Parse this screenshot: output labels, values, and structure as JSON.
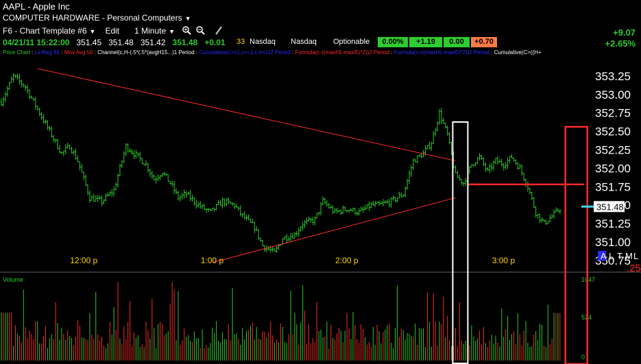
{
  "header": {
    "title": "AAPL - Apple Inc",
    "industry": "COMPUTER HARDWARE - Personal Computers",
    "template": "F6 - Chart Template #6",
    "edit": "Edit",
    "interval": "1 Minute",
    "zoom_in_icon": "zoom-in-icon",
    "zoom_out_icon": "zoom-out-icon",
    "draw_icon": "pencil-icon",
    "exch_count": "33",
    "exch1": "Nasdaq",
    "exch2": "Nasdaq",
    "optionable": "Optionable",
    "box1": "0.00%",
    "box2": "+1.19",
    "box3": "0.00",
    "box4": "+0.70",
    "change_abs": "+9.07",
    "change_pct": "+2.65%"
  },
  "quote": {
    "datetime": "04/21/11 15:22:00",
    "open": "351.45",
    "high": "351.48",
    "low": "351.42",
    "close": "351.48",
    "change": "+0.01"
  },
  "legend": [
    {
      "text": "Price Chart",
      "color": "#2ecc2e"
    },
    {
      "text": " : ",
      "color": "#ffd400"
    },
    {
      "text": "LinReg 65",
      "color": "#2a2aff"
    },
    {
      "text": " : ",
      "color": "#ffd400"
    },
    {
      "text": "Mov Avg 50",
      "color": "#ff2a2a"
    },
    {
      "text": " : ",
      "color": "#ffd400"
    },
    {
      "text": "Channel(c,H-(.5*(.5*(avgH15...)1 Period",
      "color": "#ffffff"
    },
    {
      "text": " : ",
      "color": "#ffd400"
    },
    {
      "text": "Cumulative(c>c1,c<c1,c-h<c)2 Period",
      "color": "#2a2aff"
    },
    {
      "text": " : ",
      "color": "#ffd400"
    },
    {
      "text": "Formula(c-((maxh5-maxl5)*2))2 Period",
      "color": "#ff2a2a"
    },
    {
      "text": " : ",
      "color": "#ffd400"
    },
    {
      "text": "Formula(c+((maxh5-maxl5)*2))2 Period",
      "color": "#2a2aff"
    },
    {
      "text": " : ",
      "color": "#ffd400"
    },
    {
      "text": "Cumulative(C>((H+",
      "color": "#ffffff"
    }
  ],
  "price_labels": [
    "353.25",
    "353.00",
    "352.75",
    "352.50",
    "352.25",
    "352.00",
    "351.75",
    "351.50",
    "351.25",
    "351.00",
    "350.75"
  ],
  "time_labels": [
    "12:00 p",
    "1:00 p",
    "2:00 p",
    "3:00 p"
  ],
  "last_price": "351.48",
  "scale_letters": [
    "A",
    "L",
    "T",
    "M",
    "L"
  ],
  "zero_label": ".25",
  "volume_title": "Volume",
  "volume_labels": [
    "1047",
    "524",
    "0"
  ],
  "colors": {
    "up": "#2ecc2e",
    "down": "#ff2a2a",
    "highlight": "#3ad7e6",
    "axis_time": "#ffd400"
  },
  "chart_data": {
    "type": "candlestick",
    "symbol": "AAPL",
    "interval": "1 Minute",
    "ylim": [
      350.6,
      353.5
    ],
    "x_ticks": [
      "12:00 p",
      "1:00 p",
      "2:00 p",
      "3:00 p"
    ],
    "close_path": [
      [
        0,
        352.9
      ],
      [
        6,
        353.25
      ],
      [
        12,
        353.1
      ],
      [
        20,
        352.7
      ],
      [
        26,
        352.4
      ],
      [
        30,
        352.2
      ],
      [
        34,
        352.3
      ],
      [
        38,
        352.1
      ],
      [
        44,
        351.6
      ],
      [
        50,
        351.55
      ],
      [
        56,
        351.7
      ],
      [
        62,
        352.3
      ],
      [
        66,
        352.2
      ],
      [
        72,
        352.05
      ],
      [
        76,
        351.85
      ],
      [
        80,
        351.95
      ],
      [
        84,
        351.8
      ],
      [
        88,
        351.6
      ],
      [
        92,
        351.65
      ],
      [
        98,
        351.5
      ],
      [
        104,
        351.4
      ],
      [
        110,
        351.55
      ],
      [
        116,
        351.5
      ],
      [
        120,
        351.35
      ],
      [
        126,
        351.2
      ],
      [
        130,
        350.95
      ],
      [
        136,
        350.85
      ],
      [
        140,
        351.05
      ],
      [
        146,
        351.1
      ],
      [
        150,
        351.25
      ],
      [
        156,
        351.3
      ],
      [
        160,
        351.55
      ],
      [
        166,
        351.4
      ],
      [
        172,
        351.45
      ],
      [
        178,
        351.4
      ],
      [
        184,
        351.5
      ],
      [
        188,
        351.5
      ],
      [
        194,
        351.55
      ],
      [
        200,
        351.65
      ],
      [
        205,
        352.1
      ],
      [
        210,
        352.2
      ],
      [
        214,
        352.35
      ],
      [
        218,
        352.75
      ],
      [
        222,
        352.45
      ],
      [
        226,
        351.9
      ],
      [
        230,
        351.8
      ],
      [
        234,
        352.05
      ],
      [
        238,
        352.15
      ],
      [
        242,
        351.95
      ],
      [
        246,
        352.1
      ],
      [
        250,
        352.05
      ],
      [
        254,
        352.15
      ],
      [
        258,
        352.0
      ],
      [
        262,
        351.75
      ],
      [
        266,
        351.4
      ],
      [
        270,
        351.25
      ],
      [
        274,
        351.35
      ],
      [
        278,
        351.45
      ]
    ],
    "trendlines": [
      {
        "from": [
          18,
          353.35
        ],
        "to": [
          226,
          352.1
        ],
        "color": "#ff2a2a"
      },
      {
        "from": [
          105,
          350.72
        ],
        "to": [
          226,
          351.6
        ],
        "color": "#ff2a2a"
      },
      {
        "from": [
          232,
          351.78
        ],
        "to": [
          290,
          351.78
        ],
        "color": "#ff2a2a"
      }
    ],
    "volume_max": 1047,
    "volume_ticks": [
      1047,
      524,
      0
    ]
  }
}
